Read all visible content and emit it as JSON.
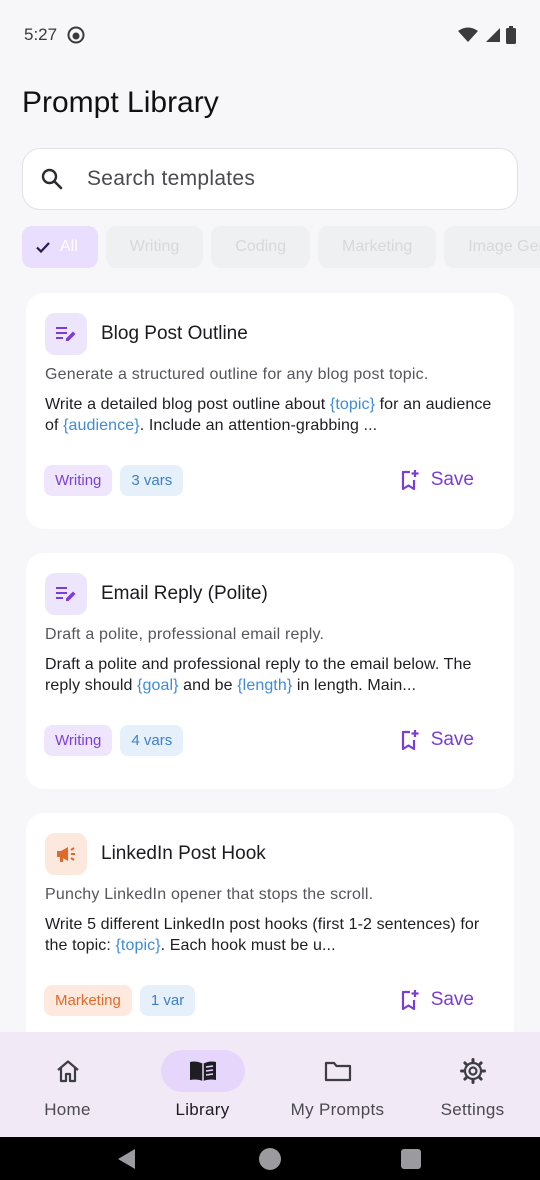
{
  "status_bar": {
    "time": "5:27"
  },
  "header": {
    "title": "Prompt Library"
  },
  "search": {
    "placeholder": "Search templates"
  },
  "filters": [
    {
      "label": "All",
      "active": true
    },
    {
      "label": "Writing",
      "active": false
    },
    {
      "label": "Coding",
      "active": false
    },
    {
      "label": "Marketing",
      "active": false
    },
    {
      "label": "Image Gen",
      "active": false
    }
  ],
  "cards": [
    {
      "title": "Blog Post Outline",
      "icon": "edit-note-icon",
      "description": "Generate a structured outline for any blog post topic.",
      "body_parts": [
        "Write a detailed blog post outline about ",
        "{topic}",
        " for an audience of ",
        "{audience}",
        ". Include an attention-grabbing ..."
      ],
      "category": "Writing",
      "vars": "3 vars",
      "save_label": "Save"
    },
    {
      "title": "Email Reply (Polite)",
      "icon": "edit-note-icon",
      "description": "Draft a polite, professional email reply.",
      "body_parts": [
        "Draft a polite and professional reply to the email below. The reply should ",
        "{goal}",
        " and be ",
        "{length}",
        " in length. Main..."
      ],
      "category": "Writing",
      "vars": "4 vars",
      "save_label": "Save"
    },
    {
      "title": "LinkedIn Post Hook",
      "icon": "megaphone-icon",
      "description": "Punchy LinkedIn opener that stops the scroll.",
      "body_parts": [
        "Write 5 different LinkedIn post hooks (first 1-2 sentences) for the topic: ",
        "{topic}",
        ". Each hook must be u..."
      ],
      "category": "Marketing",
      "vars": "1 var",
      "save_label": "Save"
    }
  ],
  "bottom_nav": [
    {
      "label": "Home",
      "icon": "home-icon",
      "active": false
    },
    {
      "label": "Library",
      "icon": "book-icon",
      "active": true
    },
    {
      "label": "My Prompts",
      "icon": "folder-icon",
      "active": false
    },
    {
      "label": "Settings",
      "icon": "gear-icon",
      "active": false
    }
  ],
  "colors": {
    "accent": "#7a3dd7",
    "variable": "#3e8bd8",
    "marketing": "#e06a2c",
    "nav_background": "#f1e9f5"
  }
}
